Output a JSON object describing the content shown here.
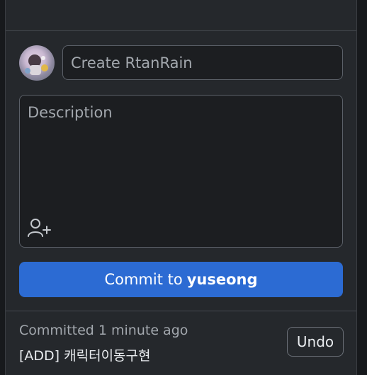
{
  "commit_form": {
    "summary_placeholder": "Create RtanRain",
    "description_placeholder": "Description",
    "coauthor_icon": "add-person-icon",
    "commit_button": {
      "prefix": "Commit to",
      "branch": "yuseong"
    }
  },
  "last_commit": {
    "time_label": "Committed 1 minute ago",
    "message": "[ADD] 캐릭터이동구현",
    "undo_label": "Undo"
  },
  "colors": {
    "panel_bg": "#25282c",
    "input_bg": "#1c1e21",
    "accent": "#2c6bd3",
    "border": "#5b6068"
  }
}
